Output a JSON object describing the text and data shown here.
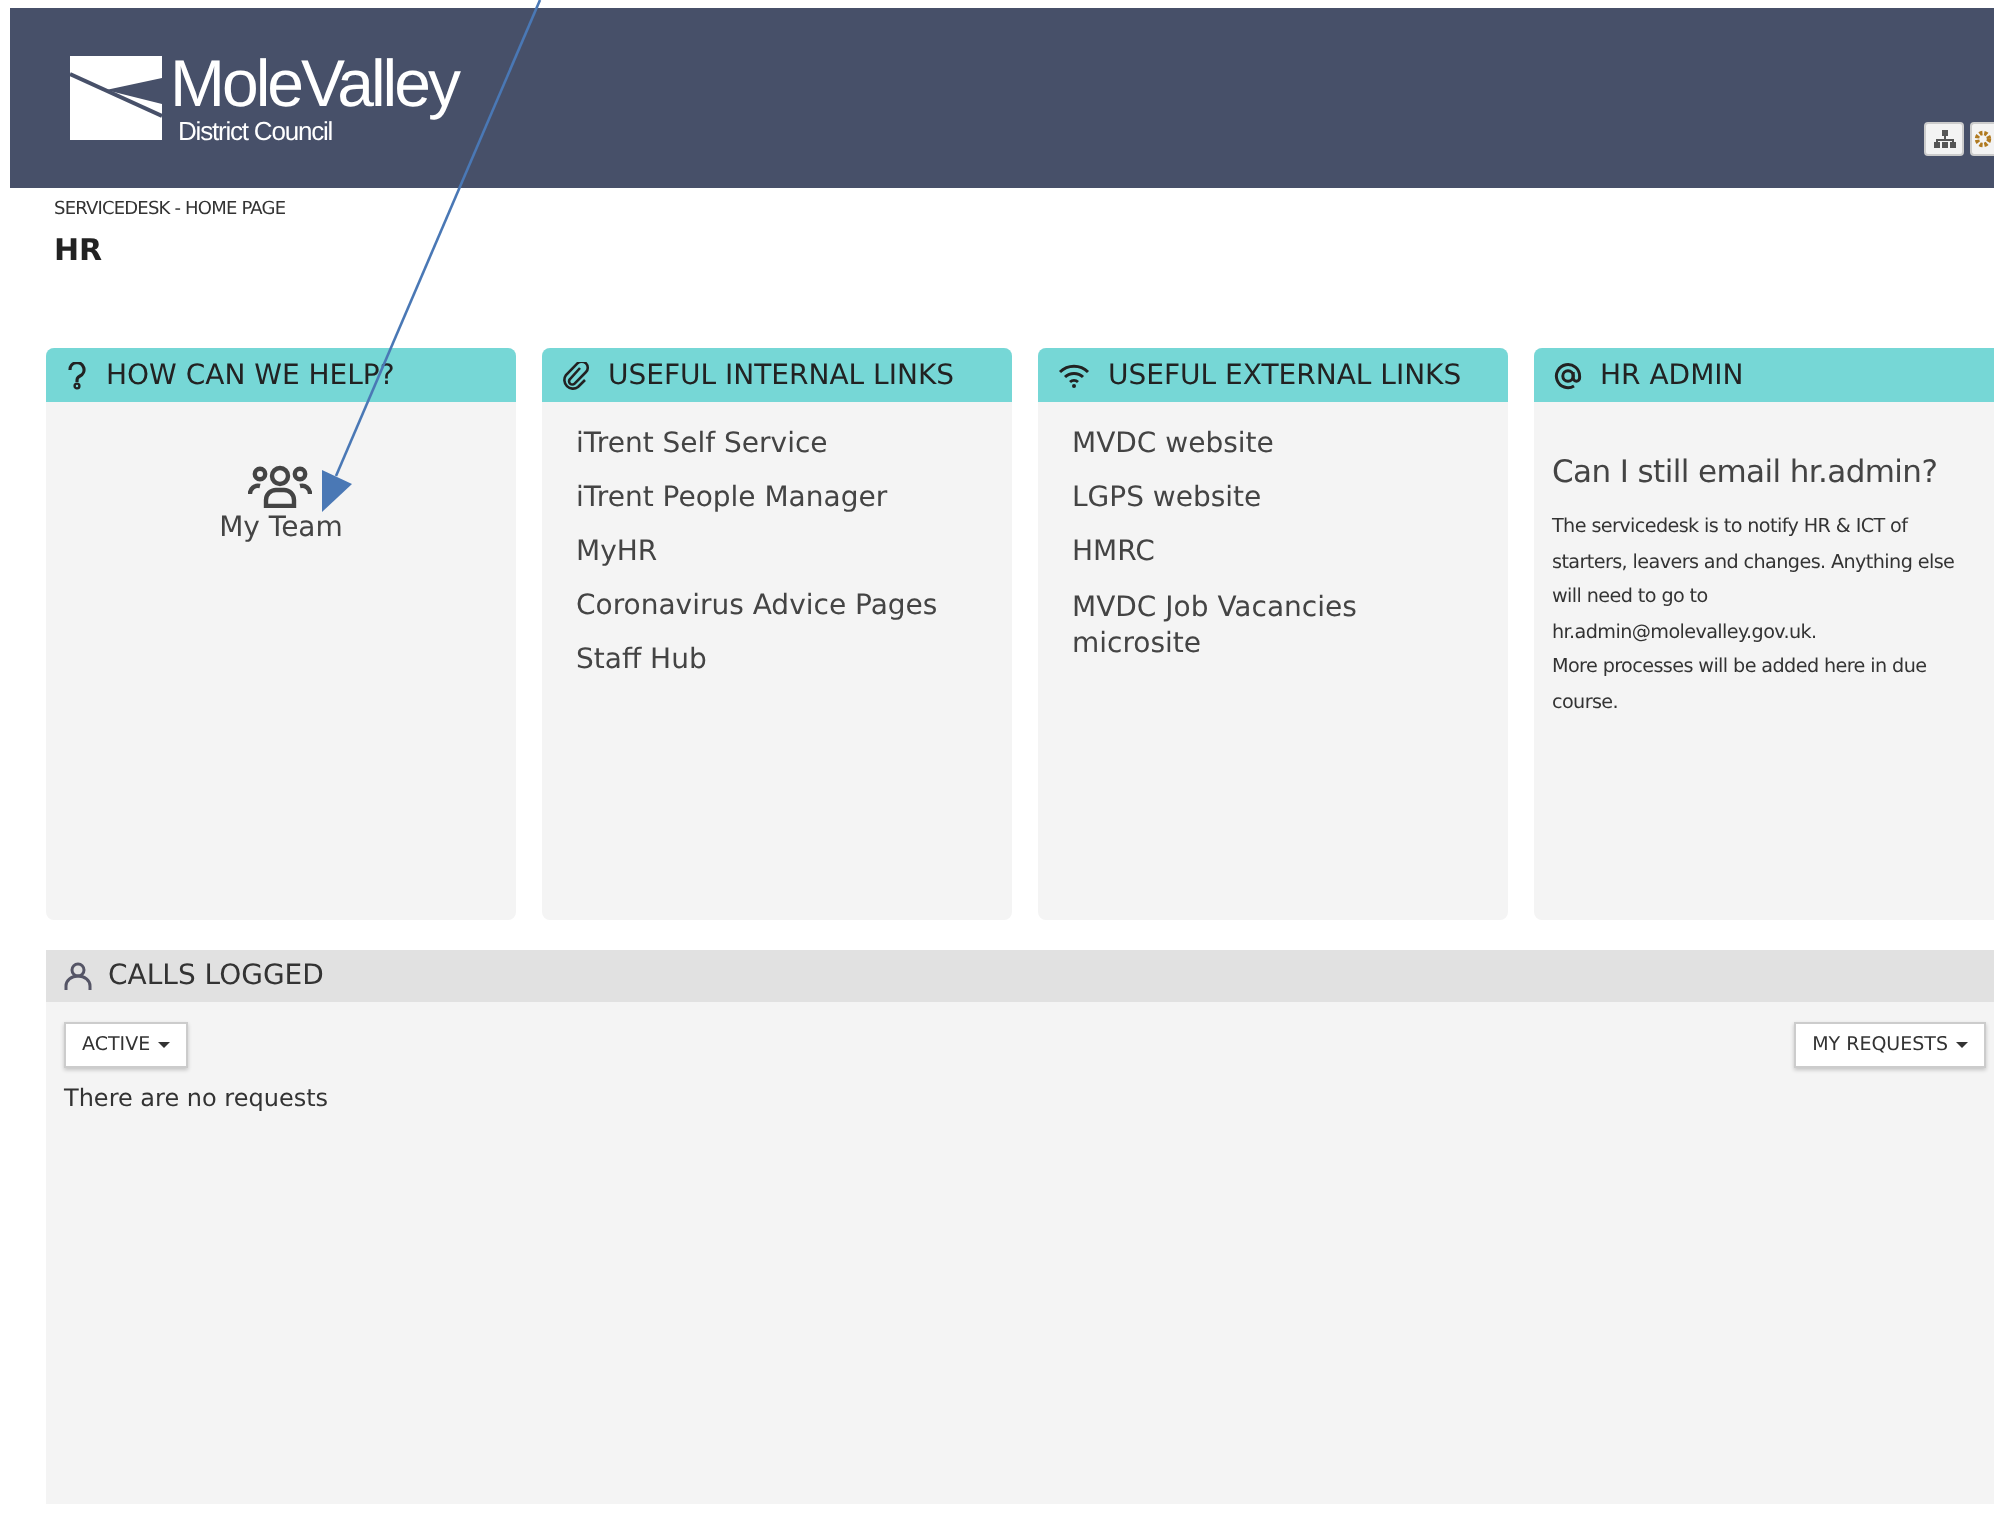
{
  "header": {
    "logo_name": "MoleValley",
    "logo_subtitle": "District Council"
  },
  "breadcrumb": "SERVICEDESK - HOME PAGE",
  "page_title": "HR",
  "cards": [
    {
      "kind": "tiles",
      "title": "HOW CAN WE HELP?",
      "tiles": [
        {
          "label": "My Team"
        }
      ]
    },
    {
      "kind": "links",
      "title": "USEFUL INTERNAL LINKS",
      "links": [
        "iTrent Self Service",
        "iTrent People Manager",
        "MyHR",
        "Coronavirus Advice Pages",
        "Staff Hub"
      ]
    },
    {
      "kind": "links",
      "title": "USEFUL EXTERNAL LINKS",
      "links": [
        "MVDC website",
        "LGPS website",
        "HMRC",
        "MVDC Job Vacancies microsite"
      ]
    },
    {
      "kind": "info",
      "title": "HR ADMIN",
      "heading": "Can I still email hr.admin?",
      "paragraphs": [
        "The servicedesk is to notify HR & ICT of starters, leavers and changes. Anything else will need to go to hr.admin@molevalley.gov.uk.",
        "More processes will be added here in due course."
      ]
    }
  ],
  "calls": {
    "title": "CALLS LOGGED",
    "filter": "ACTIVE",
    "scope": "MY REQUESTS",
    "empty_message": "There are no requests"
  }
}
